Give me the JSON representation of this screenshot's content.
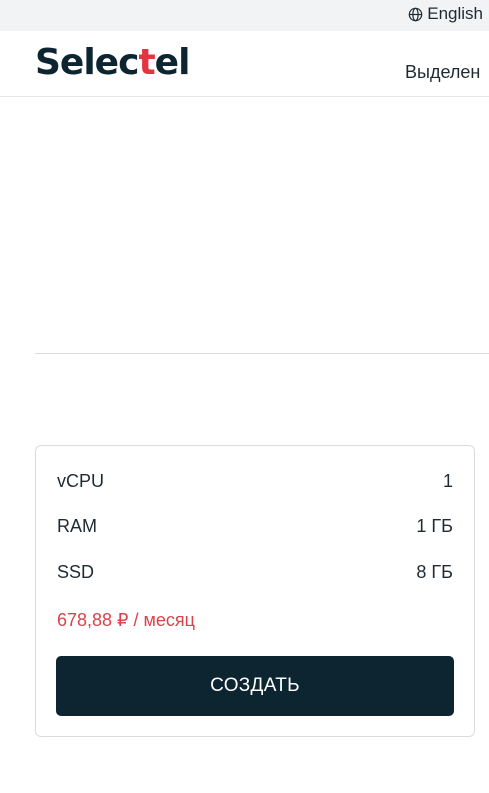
{
  "topbar": {
    "language_label": "English",
    "language_icon": "globe-icon"
  },
  "header": {
    "logo": {
      "before": "Selec",
      "accent": "t",
      "after": "el",
      "accent_color": "#e3353f",
      "text_color": "#0d2431"
    },
    "nav_item": "Выделен"
  },
  "config_card": {
    "specs": [
      {
        "label": "vCPU",
        "value": "1"
      },
      {
        "label": "RAM",
        "value": "1 ГБ"
      },
      {
        "label": "SSD",
        "value": "8 ГБ"
      }
    ],
    "price": "678,88 ₽ / месяц",
    "price_color": "#d9434b",
    "create_button_label": "СОЗДАТЬ",
    "button_color": "#0d2431"
  }
}
